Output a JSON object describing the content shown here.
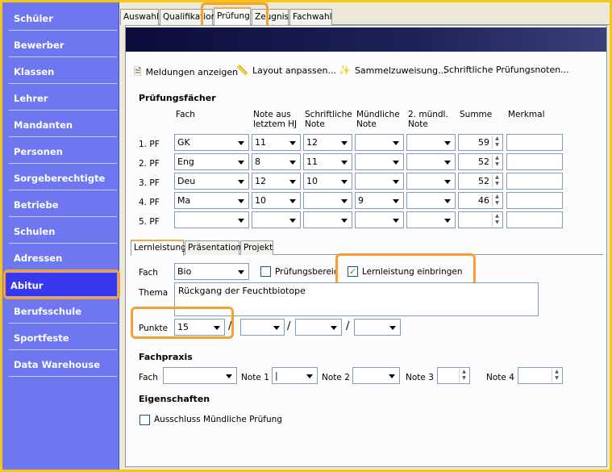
{
  "sidebar": {
    "items": [
      {
        "label": "Schüler"
      },
      {
        "label": "Bewerber"
      },
      {
        "label": "Klassen"
      },
      {
        "label": "Lehrer"
      },
      {
        "label": "Mandanten"
      },
      {
        "label": "Personen"
      },
      {
        "label": "Sorgeberechtigte"
      },
      {
        "label": "Betriebe"
      },
      {
        "label": "Schulen"
      },
      {
        "label": "Adressen"
      },
      {
        "label": "Abitur"
      },
      {
        "label": "Berufsschule"
      },
      {
        "label": "Sportfeste"
      },
      {
        "label": "Data Warehouse"
      }
    ],
    "active": "Abitur"
  },
  "tabs": [
    "Auswahl",
    "Qualifikation",
    "Prüfung",
    "Zeugnis",
    "Fachwahl"
  ],
  "active_tab": "Prüfung",
  "toolbar": {
    "meldungen": "Meldungen anzeigen",
    "layout": "Layout anpassen...",
    "sammel": "Sammelzuweisung...",
    "schriftlich": "Schriftliche Prüfungsnoten..."
  },
  "pruefungsfaecher": {
    "title": "Prüfungsfächer",
    "headers": {
      "fach": "Fach",
      "note_hj_1": "Note aus",
      "note_hj_2": "letztem HJ",
      "schriftlich_1": "Schriftliche",
      "schriftlich_2": "Note",
      "muendlich_1": "Mündliche",
      "muendlich_2": "Note",
      "muendlich2_1": "2. mündl.",
      "muendlich2_2": "Note",
      "summe": "Summe",
      "merkmal": "Merkmal"
    },
    "rows": [
      {
        "label": "1. PF",
        "fach": "GK",
        "note_hj": "11",
        "schriftlich": "12",
        "muendlich": "",
        "muendlich2": "",
        "summe": "59"
      },
      {
        "label": "2. PF",
        "fach": "Eng",
        "note_hj": "8",
        "schriftlich": "11",
        "muendlich": "",
        "muendlich2": "",
        "summe": "52"
      },
      {
        "label": "3. PF",
        "fach": "Deu",
        "note_hj": "12",
        "schriftlich": "10",
        "muendlich": "",
        "muendlich2": "",
        "summe": "52"
      },
      {
        "label": "4. PF",
        "fach": "Ma",
        "note_hj": "10",
        "schriftlich": "",
        "muendlich": "9",
        "muendlich2": "",
        "summe": "46"
      },
      {
        "label": "5. PF",
        "fach": "",
        "note_hj": "",
        "schriftlich": "",
        "muendlich": "",
        "muendlich2": "",
        "summe": ""
      }
    ]
  },
  "subtabs": [
    "Lernleistung",
    "Präsentation",
    "Projekt"
  ],
  "active_subtab": "Lernleistung",
  "lernleistung": {
    "fach_label": "Fach",
    "fach_value": "Bio",
    "pruefungsbereich_label": "Prüfungsbereich",
    "pruefungsbereich_checked": false,
    "einbringen_label": "Lernleistung einbringen",
    "einbringen_checked": true,
    "thema_label": "Thema",
    "thema_value": "Rückgang der Feuchtbiotope",
    "punkte_label": "Punkte",
    "punkte_value": "15",
    "separator": "/"
  },
  "fachpraxis": {
    "title": "Fachpraxis",
    "fach_label": "Fach",
    "note1_label": "Note 1",
    "note1_value": "|",
    "note2_label": "Note 2",
    "note3_label": "Note 3",
    "note4_label": "Note 4"
  },
  "eigenschaften": {
    "title": "Eigenschaften",
    "ausschluss_label": "Ausschluss Mündliche Prüfung",
    "ausschluss_checked": false
  },
  "icons": {
    "meldungen": "document-icon",
    "layout": "ruler-icon",
    "sammel": "wand-icon",
    "spin_up": "▲",
    "spin_down": "▼",
    "check": "✓"
  },
  "colors": {
    "sidebar_bg": "#6e76f0",
    "sidebar_active": "#3838ee",
    "highlight": "#f5a030",
    "frame": "#f5c518"
  }
}
